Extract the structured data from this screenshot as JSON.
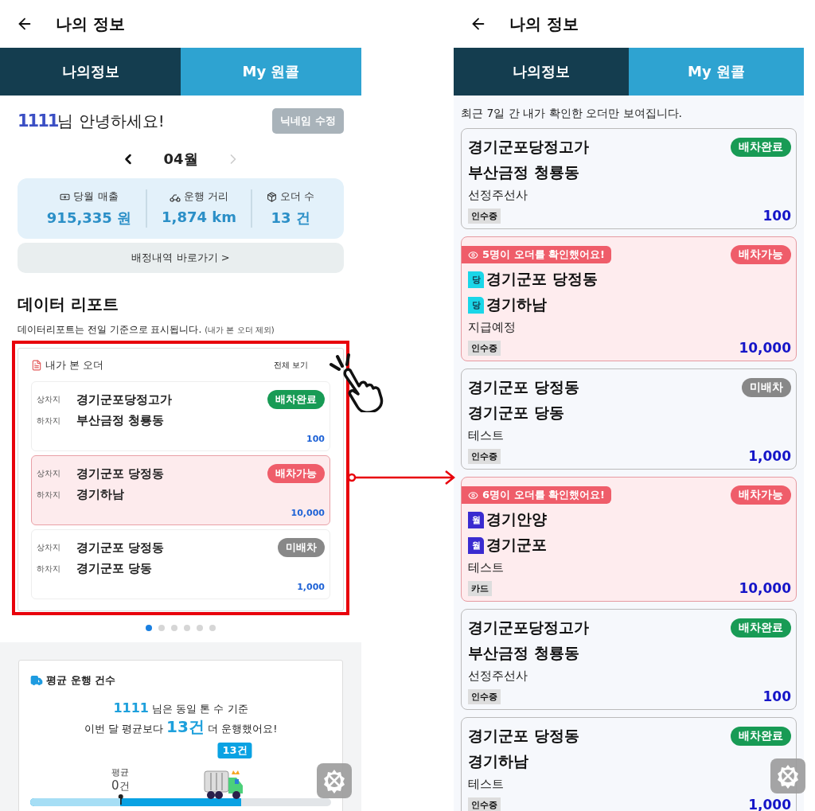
{
  "left_screen": {
    "header": {
      "title": "나의 정보"
    },
    "tabs": [
      {
        "label": "나의정보",
        "selected": true
      },
      {
        "label": "My 원콜",
        "selected": false
      }
    ],
    "greeting": {
      "name": "1111",
      "text": "님 안녕하세요!"
    },
    "nickname_button": "닉네임 수정",
    "month": {
      "label": "04월",
      "next_disabled": true
    },
    "stats": [
      {
        "kind": "revenue",
        "label": "당월 매출",
        "value": "915,335 원"
      },
      {
        "kind": "distance",
        "label": "운행 거리",
        "value": "1,874 km"
      },
      {
        "kind": "orders",
        "label": "오더 수",
        "value": "13 건"
      }
    ],
    "history_button": "배정내역 바로가기 >",
    "report": {
      "title": "데이터 리포트",
      "note": "데이터리포트는 전일 기준으로 표시됩니다.",
      "note_small": "(내가 본 오더 제외)"
    },
    "viewed_orders": {
      "title": "내가 본 오더",
      "view_all": "전체 보기",
      "orders": [
        {
          "pickup_label": "상차지",
          "pickup": "경기군포당정고가",
          "dropoff_label": "하차지",
          "dropoff": "부산금정 청룡동",
          "status": {
            "text": "배차완료",
            "color": "#189b55"
          },
          "amount": "100",
          "highlighted": false
        },
        {
          "pickup_label": "상차지",
          "pickup": "경기군포 당정동",
          "dropoff_label": "하차지",
          "dropoff": "경기하남",
          "status": {
            "text": "배차가능",
            "color": "#ef5d6a"
          },
          "amount": "10,000",
          "highlighted": true
        },
        {
          "pickup_label": "상차지",
          "pickup": "경기군포 당정동",
          "dropoff_label": "하차지",
          "dropoff": "경기군포 당동",
          "status": {
            "text": "미배차",
            "color": "#888888"
          },
          "amount": "1,000",
          "highlighted": false
        }
      ]
    },
    "pager": [
      {
        "selected": true
      },
      {
        "selected": false
      },
      {
        "selected": false
      },
      {
        "selected": false
      },
      {
        "selected": false
      },
      {
        "selected": false
      }
    ],
    "average": {
      "title": "평균 운행 건수",
      "line_1": [
        {
          "text": "1111",
          "highlight": true
        },
        {
          "text": " 님은 동일 톤 수 기준",
          "highlight": false
        }
      ],
      "line_2": [
        {
          "text": "이번 달 평균보다 ",
          "highlight": false
        },
        {
          "text": "13건",
          "highlight": true
        },
        {
          "text": " 더 운행했어요!",
          "highlight": false
        }
      ],
      "average_marker": {
        "label": "평균",
        "value": "0",
        "unit": "건",
        "level": 0.3
      },
      "my_bar": {
        "badge": "13건",
        "level": 0.7
      }
    }
  },
  "right_screen": {
    "header": {
      "title": "나의 정보"
    },
    "tabs": [
      {
        "label": "나의정보",
        "selected": true
      },
      {
        "label": "My 원콜",
        "selected": false
      }
    ],
    "notice": "최근 7일 간 내가 확인한 오더만 보여집니다.",
    "orders": [
      {
        "origin": "경기군포당정고가",
        "destination": "부산금정 청룡동",
        "status": {
          "text": "배차완료",
          "color": "#189b55"
        },
        "memo": "선정주선사",
        "payment": "인수증",
        "amount": "100",
        "highlighted": false
      },
      {
        "viewers": "5명이 오더를 확인했어요!",
        "origin_badge": {
          "text": "당",
          "kind": "dang"
        },
        "origin": "경기군포 당정동",
        "destination_badge": {
          "text": "당",
          "kind": "dang"
        },
        "destination": "경기하남",
        "status": {
          "text": "배차가능",
          "color": "#ef5d6a"
        },
        "memo": "지급예정",
        "payment": "인수증",
        "amount": "10,000",
        "highlighted": true
      },
      {
        "origin": "경기군포 당정동",
        "destination": "경기군포 당동",
        "status": {
          "text": "미배차",
          "color": "#888888"
        },
        "memo": "테스트",
        "payment": "인수증",
        "amount": "1,000",
        "highlighted": false
      },
      {
        "viewers": "6명이 오더를 확인했어요!",
        "origin_badge": {
          "text": "월",
          "kind": "wol"
        },
        "origin": "경기안양",
        "destination_badge": {
          "text": "월",
          "kind": "wol"
        },
        "destination": "경기군포",
        "status": {
          "text": "배차가능",
          "color": "#ef5d6a"
        },
        "memo": "테스트",
        "payment": "카드",
        "amount": "10,000",
        "highlighted": true
      },
      {
        "origin": "경기군포당정고가",
        "destination": "부산금정 청룡동",
        "status": {
          "text": "배차완료",
          "color": "#189b55"
        },
        "memo": "선정주선사",
        "payment": "인수증",
        "amount": "100",
        "highlighted": false
      },
      {
        "origin": "경기군포 당정동",
        "destination": "경기하남",
        "status": {
          "text": "배차완료",
          "color": "#189b55"
        },
        "memo": "테스트",
        "payment": "인수증",
        "amount": "1,000",
        "highlighted": false
      }
    ]
  }
}
